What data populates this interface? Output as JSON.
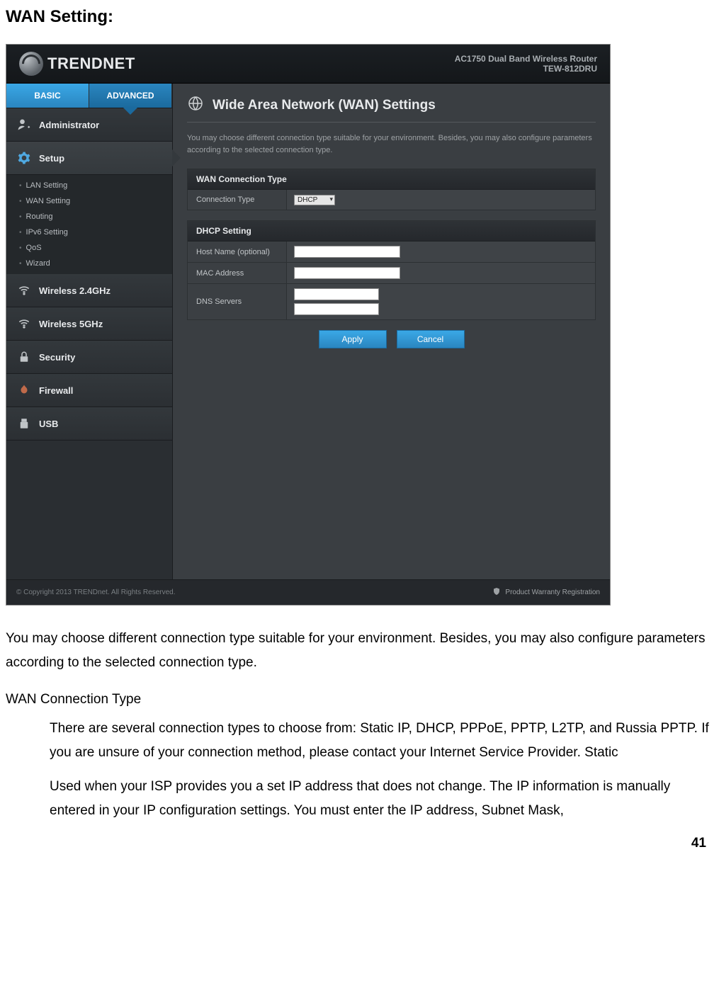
{
  "page": {
    "title": "WAN Setting:",
    "number": "41"
  },
  "router": {
    "brand": "TRENDNET",
    "product_line": "AC1750 Dual Band Wireless Router",
    "model": "TEW-812DRU",
    "tabs": {
      "basic": "BASIC",
      "advanced": "ADVANCED"
    },
    "nav": {
      "administrator": "Administrator",
      "setup": "Setup",
      "setup_sub": [
        "LAN Setting",
        "WAN Setting",
        "Routing",
        "IPv6 Setting",
        "QoS",
        "Wizard"
      ],
      "wireless24": "Wireless 2.4GHz",
      "wireless5": "Wireless 5GHz",
      "security": "Security",
      "firewall": "Firewall",
      "usb": "USB"
    },
    "main": {
      "title": "Wide Area Network (WAN) Settings",
      "desc": "You may choose different connection type suitable for your environment. Besides, you may also configure parameters according to the selected connection type.",
      "panel1": {
        "header": "WAN Connection Type",
        "row1_label": "Connection Type",
        "row1_value": "DHCP"
      },
      "panel2": {
        "header": "DHCP Setting",
        "row1_label": "Host Name (optional)",
        "row2_label": "MAC Address",
        "row3_label": "DNS Servers"
      },
      "buttons": {
        "apply": "Apply",
        "cancel": "Cancel"
      }
    },
    "footer": {
      "copyright": "© Copyright 2013 TRENDnet. All Rights Reserved.",
      "warranty": "Product Warranty Registration"
    }
  },
  "doc": {
    "para1": "You may choose different connection type suitable for your environment. Besides, you may also configure parameters according to the selected connection type.",
    "subhead": "WAN Connection Type",
    "para2": "There are several connection types to choose from: Static IP, DHCP, PPPoE, PPTP, L2TP, and Russia PPTP. If you are unsure of your connection method, please contact your Internet Service Provider. Static",
    "para3": "Used when your ISP provides you a set IP address that does not change. The IP information is manually entered in your IP configuration settings. You must enter the IP address, Subnet Mask,"
  }
}
